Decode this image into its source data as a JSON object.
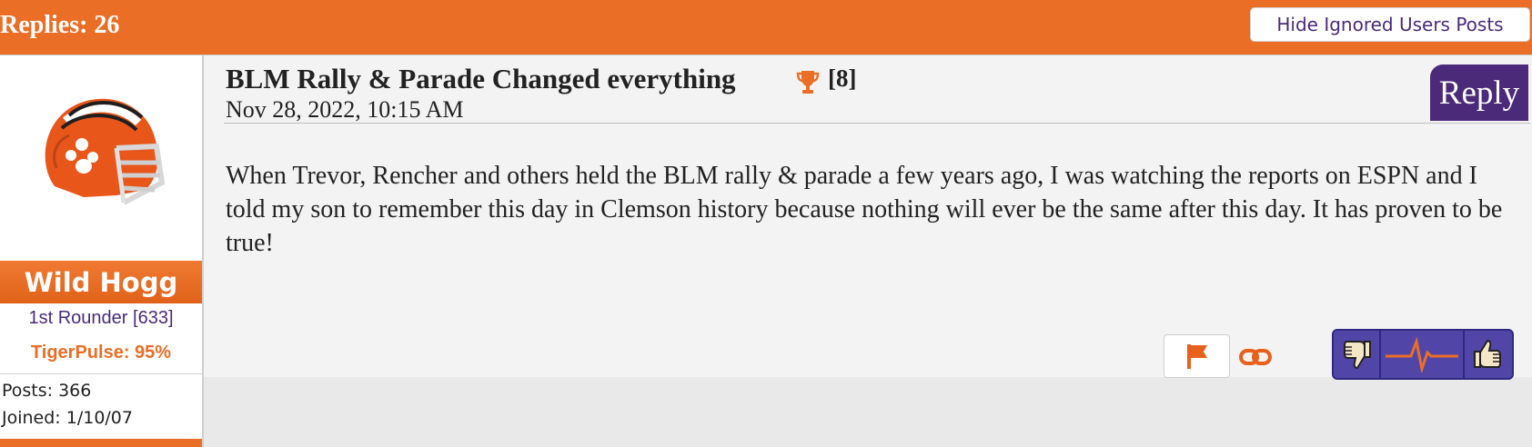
{
  "header": {
    "replies": "Replies: 26",
    "hide_ignored": "Hide Ignored Users Posts"
  },
  "post": {
    "author": {
      "name": "Wild Hogg",
      "rank": "1st Rounder [633]",
      "tigerpulse": "TigerPulse: 95%",
      "posts": "Posts: 366",
      "joined": "Joined: 1/10/07"
    },
    "title": "BLM Rally & Parade Changed everything",
    "trophy_count": "[8]",
    "date": "Nov 28, 2022, 10:15 AM",
    "reply_label": "Reply",
    "body": "When Trevor, Rencher and others held the BLM rally & parade a few years ago, I was watching the reports on ESPN and I told my son to remember this day in Clemson history because nothing will ever be the same after this day. It has proven to be true!"
  },
  "icons": {
    "trophy": "trophy-icon",
    "flag": "flag-icon",
    "link": "link-icon",
    "thumbs_down": "thumbs-down-icon",
    "pulse": "pulse-icon",
    "thumbs_up": "thumbs-up-icon",
    "avatar": "football-helmet-icon"
  },
  "colors": {
    "orange": "#ea6e25",
    "purple": "#4b2a7a",
    "vote_purple": "#5146a8"
  }
}
